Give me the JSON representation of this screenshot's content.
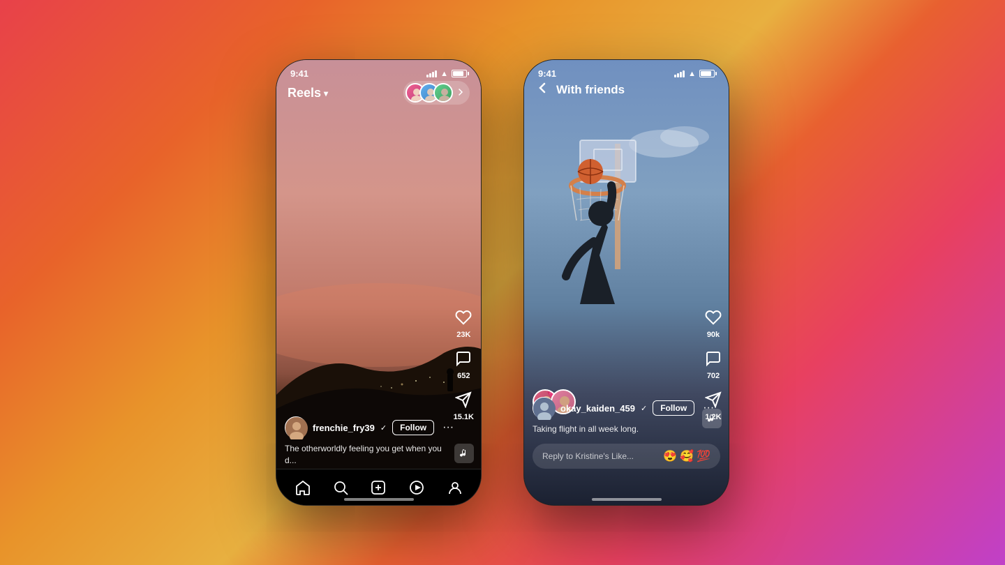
{
  "background": {
    "gradient": "orange-pink"
  },
  "phone1": {
    "status": {
      "time": "9:41",
      "signal": "signal-icon",
      "wifi": "wifi-icon",
      "battery": "battery-icon"
    },
    "header": {
      "title": "Reels",
      "dropdown_icon": "chevron-down"
    },
    "actions": {
      "likes": "23K",
      "comments": "652",
      "shares": "15.1K"
    },
    "user": {
      "username": "frenchie_fry39",
      "verified": true,
      "follow_label": "Follow",
      "caption": "The otherworldly feeling you get when you d..."
    },
    "nav": {
      "items": [
        "home",
        "search",
        "add",
        "reels",
        "profile"
      ]
    }
  },
  "phone2": {
    "status": {
      "time": "9:41",
      "signal": "signal-icon",
      "wifi": "wifi-icon",
      "battery": "battery-icon"
    },
    "header": {
      "back_icon": "back-arrow",
      "title": "With friends"
    },
    "actions": {
      "likes": "90k",
      "comments": "702",
      "shares": "1.2K"
    },
    "user": {
      "username": "okay_kaiden_459",
      "verified": true,
      "follow_label": "Follow",
      "caption": "Taking flight in all week long."
    },
    "reply": {
      "placeholder": "Reply to Kristine's Like...",
      "emojis": [
        "😍",
        "🥰",
        "💯"
      ]
    }
  }
}
